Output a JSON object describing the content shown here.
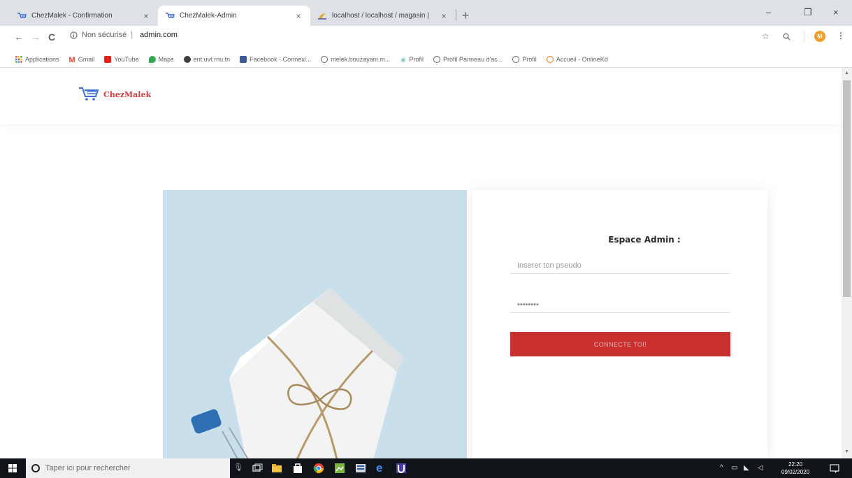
{
  "browser": {
    "tabs": [
      {
        "title": "ChezMalek - Confirmation",
        "close": "×"
      },
      {
        "title": "ChezMalek-Admin",
        "close": "×"
      },
      {
        "title": "localhost / localhost / magasin | ",
        "close": "×"
      }
    ],
    "new_tab": "+",
    "window_controls": {
      "minimize": "–",
      "restore": "❐",
      "close": "×"
    },
    "nav": {
      "back": "←",
      "forward": "→",
      "reload": "C"
    },
    "omnibox": {
      "security": "Non sécurisé",
      "url": "admin.com"
    },
    "bookmarks": [
      {
        "label": "Applications",
        "color": "#ea4335"
      },
      {
        "label": "Gmail",
        "color": "#ea4335"
      },
      {
        "label": "YouTube",
        "color": "#e62117"
      },
      {
        "label": "Maps",
        "color": "#34a853"
      },
      {
        "label": "ent.uvt.rnu.tn",
        "color": "#3c4043"
      },
      {
        "label": "Facebook - Connexi...",
        "color": "#3b5998"
      },
      {
        "label": "melek.bouzayani.m...",
        "color": "#5f6368"
      },
      {
        "label": "Profil",
        "color": "#3aa6a0"
      },
      {
        "label": "Profil Panneau d'ac...",
        "color": "#5f6368"
      },
      {
        "label": "Profil",
        "color": "#5f6368"
      },
      {
        "label": "Accueil - OnlineKd",
        "color": "#e8711a"
      }
    ],
    "profile_initial": "M"
  },
  "site": {
    "logo_text": "ChezMalek",
    "brand_color": "#d63a3a"
  },
  "login": {
    "title": "Espace Admin :",
    "username_placeholder": "Inserer ton pseudo",
    "password_value": "********",
    "submit_label": "CONNECTE TOI!",
    "accent_color": "#c8302f"
  },
  "taskbar": {
    "search_placeholder": "Taper ici pour rechercher",
    "time": "22:20",
    "date": "09/02/2020"
  }
}
